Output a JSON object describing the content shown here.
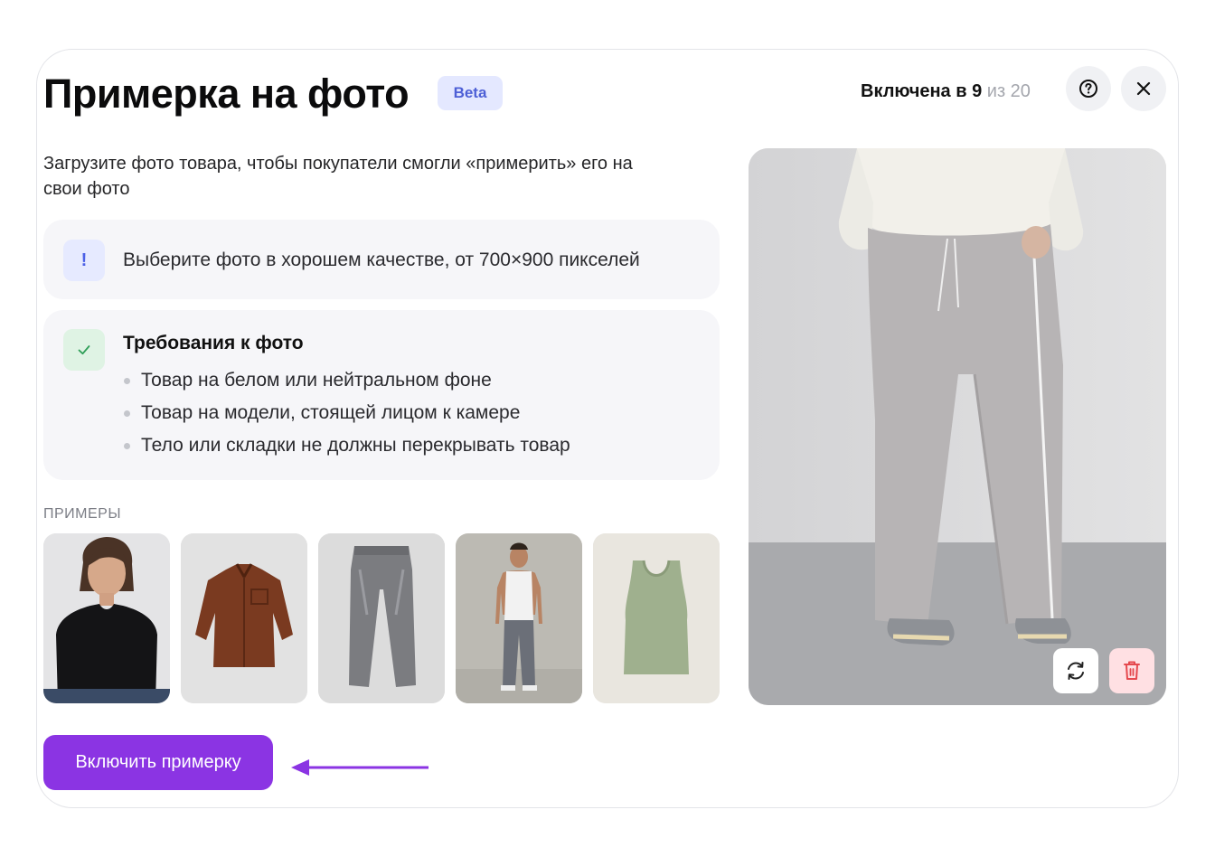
{
  "header": {
    "title": "Примерка на фото",
    "badge": "Beta",
    "counter_prefix": "Включена в 9",
    "counter_suffix": "из 20"
  },
  "subtitle": "Загрузите фото товара, чтобы покупатели смогли «примерить» его на свои фото",
  "tip": {
    "icon_glyph": "!",
    "text": "Выберите фото в хорошем качестве, от 700×900 пикселей"
  },
  "requirements": {
    "title": "Требования к фото",
    "items": [
      "Товар на белом или нейтральном фоне",
      "Товар на модели, стоящей лицом к камере",
      "Тело или складки не должны перекрывать товар"
    ]
  },
  "examples": {
    "label": "ПРИМЕРЫ",
    "items": [
      "woman-black-tshirt-photo",
      "brown-shirt-photo",
      "grey-jeans-photo",
      "man-tank-top-jeans-photo",
      "green-tank-top-photo"
    ]
  },
  "actions": {
    "enable_label": "Включить примерку"
  },
  "colors": {
    "accent": "#8b34e3",
    "beta_bg": "#e4e8ff",
    "beta_text": "#4d5fd6",
    "delete_bg": "#ffe0e3",
    "delete_icon": "#e5484d",
    "check": "#2e9e57"
  },
  "icons": {
    "help": "question-circle-icon",
    "close": "close-icon",
    "replace": "refresh-icon",
    "delete": "trash-icon",
    "tip": "exclamation-icon",
    "check": "checkmark-icon"
  }
}
